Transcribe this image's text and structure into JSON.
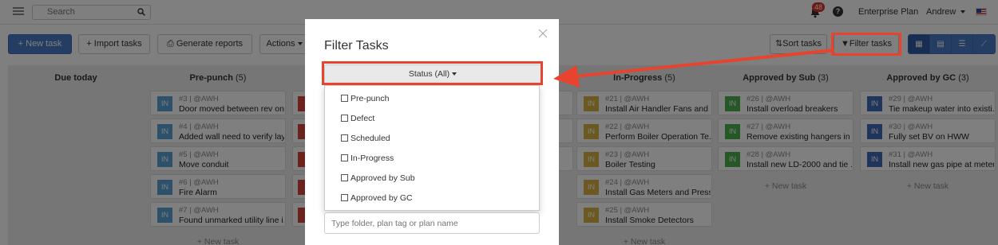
{
  "topnav": {
    "search_placeholder": "Search",
    "notifications_count": "48",
    "help_label": "?",
    "plan_label": "Enterprise Plan",
    "user_label": "Andrew"
  },
  "toolbar": {
    "new_task": "+ New task",
    "import_tasks": "+ Import tasks",
    "generate_reports": "Generate reports",
    "actions": "Actions",
    "sort_tasks": "Sort tasks",
    "filter_tasks": "Filter tasks"
  },
  "board": {
    "columns": [
      {
        "title": "Due today",
        "count": "",
        "new_task": ""
      },
      {
        "title": "Pre-punch",
        "count": "(5)",
        "new_task": "+ New task"
      },
      {
        "title": "In-Progress",
        "count": "(5)",
        "new_task": "+ New task"
      },
      {
        "title": "Approved by Sub",
        "count": "(3)",
        "new_task": "+ New task"
      },
      {
        "title": "Approved by GC",
        "count": "(3)",
        "new_task": "+ New task"
      }
    ],
    "prepunch_cards": [
      {
        "badge": "IN",
        "meta": "#3 | @AWH",
        "title": "Door moved between rev on..."
      },
      {
        "badge": "IN",
        "meta": "#4 | @AWH",
        "title": "Added wall need to verify lay..."
      },
      {
        "badge": "IN",
        "meta": "#5 | @AWH",
        "title": "Move conduit"
      },
      {
        "badge": "IN",
        "meta": "#6 | @AWH",
        "title": "Fire Alarm"
      },
      {
        "badge": "IN",
        "meta": "#7 | @AWH",
        "title": "Found unmarked utility line i..."
      }
    ],
    "inprogress_cards": [
      {
        "badge": "IN",
        "meta": "#21 | @AWH",
        "title": "Install Air Handler Fans and ..."
      },
      {
        "badge": "IN",
        "meta": "#22 | @AWH",
        "title": "Perform Boiler Operation Te..."
      },
      {
        "badge": "IN",
        "meta": "#23 | @AWH",
        "title": "Boiler Testing"
      },
      {
        "badge": "IN",
        "meta": "#24 | @AWH",
        "title": "Install Gas Meters and Press..."
      },
      {
        "badge": "IN",
        "meta": "#25 | @AWH",
        "title": "Install Smoke Detectors"
      }
    ],
    "sub_cards": [
      {
        "badge": "IN",
        "meta": "#26 | @AWH",
        "title": "Install overload breakers"
      },
      {
        "badge": "IN",
        "meta": "#27 | @AWH",
        "title": "Remove existing hangers in b..."
      },
      {
        "badge": "IN",
        "meta": "#28 | @AWH",
        "title": "Install new LD-2000 and tie ..."
      }
    ],
    "gc_cards": [
      {
        "badge": "IN",
        "meta": "#29 | @AWH",
        "title": "Tie makeup water into existi..."
      },
      {
        "badge": "IN",
        "meta": "#30 | @AWH",
        "title": "Fully set BV on HWW"
      },
      {
        "badge": "IN",
        "meta": "#31 | @AWH",
        "title": "Install new gas pipe at meter ..."
      }
    ]
  },
  "modal": {
    "title": "Filter Tasks",
    "status_button": "Status (All)",
    "status_options": [
      "Pre-punch",
      "Defect",
      "Scheduled",
      "In-Progress",
      "Approved by Sub",
      "Approved by GC"
    ],
    "plan_placeholder": "Type folder, plan tag or plan name"
  },
  "colors": {
    "primary": "#4a78c6",
    "prepunch_badge": "#5ba3d6",
    "inprogress_badge": "#d9b342",
    "sub_badge": "#4cae4c",
    "gc_badge": "#3f6bb8",
    "highlight": "#e8432e",
    "notification": "#d9302a"
  }
}
